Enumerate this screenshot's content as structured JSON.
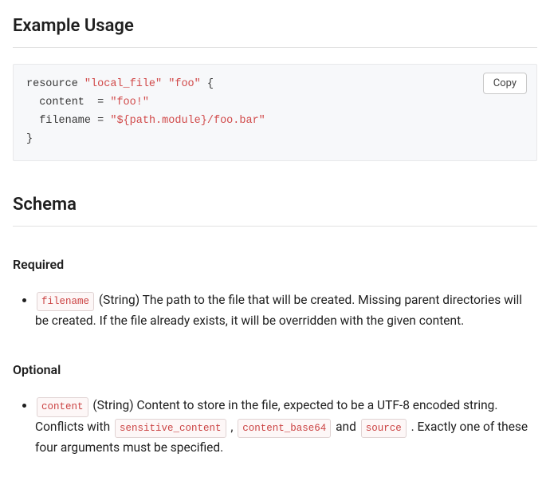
{
  "headings": {
    "example_usage": "Example Usage",
    "schema": "Schema",
    "required": "Required",
    "optional": "Optional"
  },
  "code": {
    "copy_label": "Copy",
    "tokens": {
      "kw_resource": "resource",
      "str_local_file": "\"local_file\"",
      "str_foo": "\"foo\"",
      "brace_open": "{",
      "attr_content": "content",
      "eq": "=",
      "str_content_val": "\"foo!\"",
      "attr_filename": "filename",
      "str_filename_val": "\"${path.module}/foo.bar\"",
      "brace_close": "}"
    }
  },
  "schema": {
    "required": [
      {
        "name": "filename",
        "desc_before": " (String) The path to the file that will be created. Missing parent directories will be created. If the file already exists, it will be overridden with the given content."
      }
    ],
    "optional": [
      {
        "name": "content",
        "desc_1": " (String) Content to store in the file, expected to be a UTF-8 encoded string. Conflicts with ",
        "ref1": "sensitive_content",
        "sep1": " , ",
        "ref2": "content_base64",
        "sep2": " and ",
        "ref3": "source",
        "desc_2": " . Exactly one of these four arguments must be specified."
      }
    ]
  }
}
